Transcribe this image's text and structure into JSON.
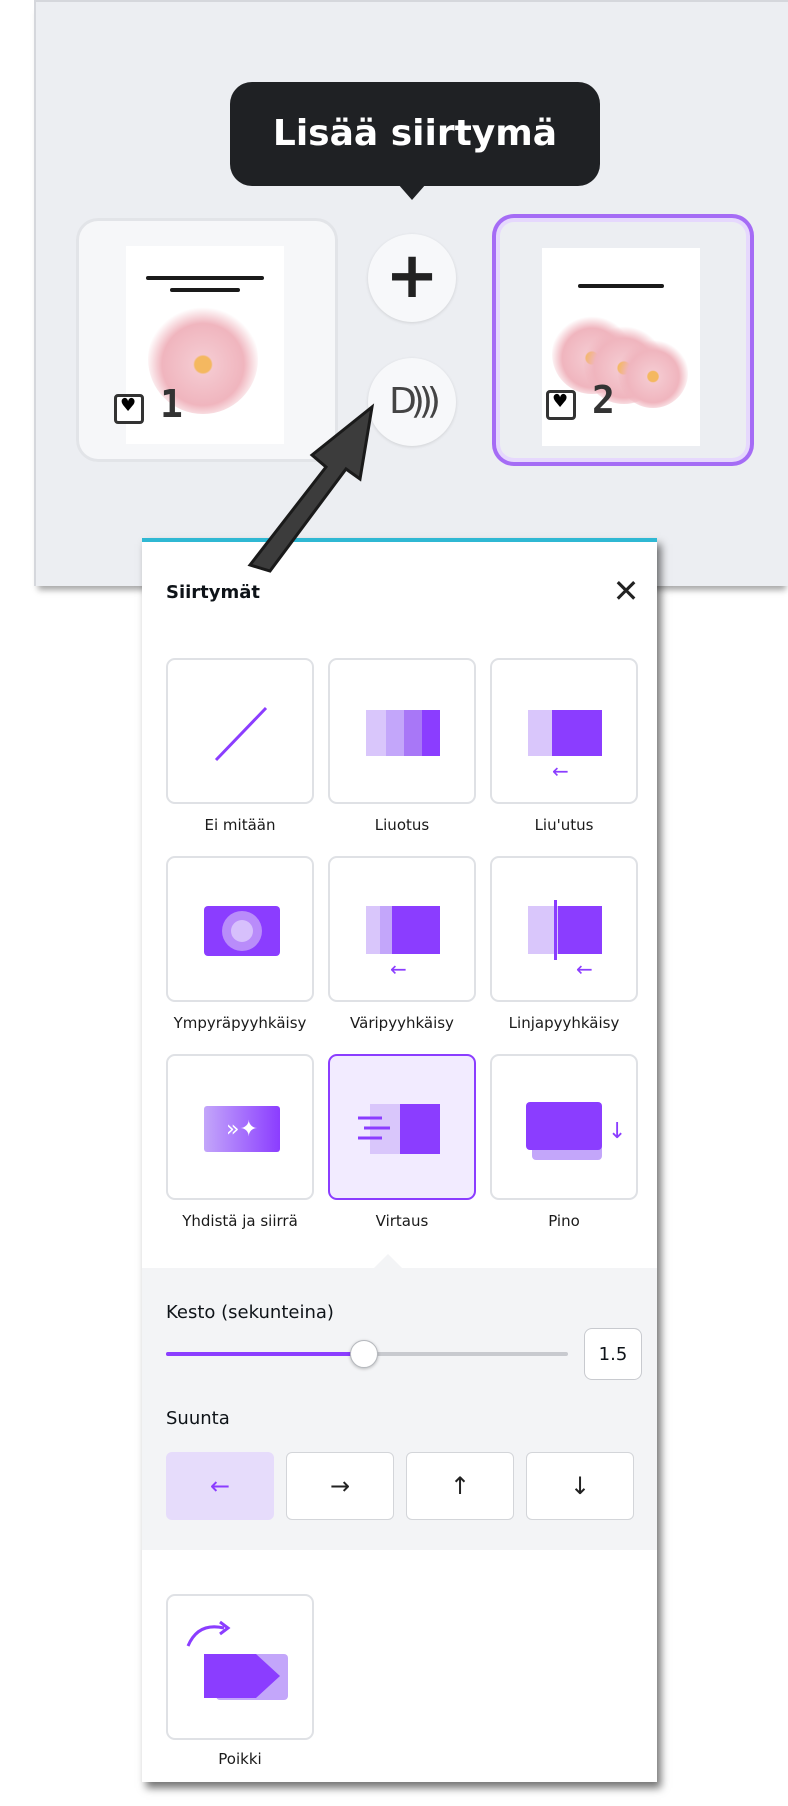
{
  "tooltip": {
    "text": "Lisää siirtymä"
  },
  "pages": [
    {
      "number": "1"
    },
    {
      "number": "2"
    }
  ],
  "panel": {
    "title": "Siirtymät",
    "transitions": [
      {
        "label": "Ei mitään"
      },
      {
        "label": "Liuotus"
      },
      {
        "label": "Liu'utus"
      },
      {
        "label": "Ympyräpyyhkäisy"
      },
      {
        "label": "Väripyyhkäisy"
      },
      {
        "label": "Linjapyyhkäisy"
      },
      {
        "label": "Yhdistä ja siirrä"
      },
      {
        "label": "Virtaus"
      },
      {
        "label": "Pino"
      }
    ],
    "selected_transition": "Virtaus",
    "duration": {
      "label": "Kesto (sekunteina)",
      "value": "1.5",
      "slider_fraction": 0.49
    },
    "direction": {
      "label": "Suunta",
      "options": [
        "←",
        "→",
        "↑",
        "↓"
      ],
      "selected": "←"
    },
    "extra": [
      {
        "label": "Poikki"
      }
    ]
  },
  "colors": {
    "accent": "#8b3dff",
    "panel_top_border": "#2fb8d3",
    "tooltip_bg": "#1f2124"
  },
  "icons": {
    "add": "plus-icon",
    "transition": "transition-icon",
    "close": "close-icon"
  }
}
